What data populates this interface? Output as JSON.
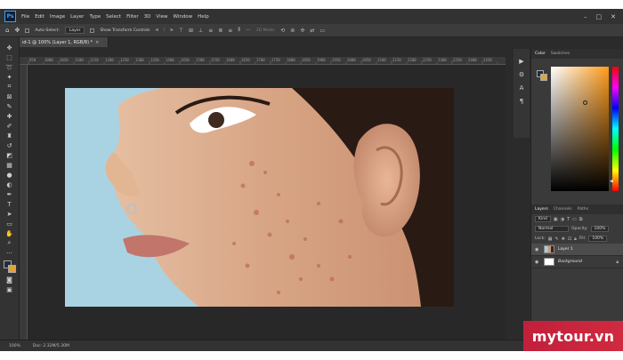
{
  "app": {
    "logo_text": "Ps"
  },
  "menu": [
    "File",
    "Edit",
    "Image",
    "Layer",
    "Type",
    "Select",
    "Filter",
    "3D",
    "View",
    "Window",
    "Help"
  ],
  "window_controls": [
    "–",
    "□",
    "✕"
  ],
  "options_bar": {
    "auto_select_label": "Auto-Select:",
    "auto_select_value": "Layer",
    "transform_label": "Show Transform Controls",
    "mode_3d_label": "3D Mode:"
  },
  "document": {
    "tab_title": "ıd-1 @ 100% (Layer 1, RGB/8) *",
    "close_glyph": "✕"
  },
  "ruler": {
    "ticks": [
      "950",
      "1000",
      "1050",
      "1100",
      "1150",
      "1200",
      "1250",
      "1300",
      "1350",
      "1400",
      "1450",
      "1500",
      "1550",
      "1600",
      "1650",
      "1700",
      "1750",
      "1800",
      "1850",
      "1900",
      "1950",
      "2000",
      "2050",
      "2100",
      "2150",
      "2200",
      "2250",
      "2300",
      "2350",
      "2400",
      "2450"
    ]
  },
  "status": {
    "zoom": "100%",
    "doc_size": "Doc: 2.32M/5.30M"
  },
  "panels": {
    "color_tabs": [
      "Color",
      "Swatches"
    ],
    "color_active": "Color",
    "colors": {
      "foreground": "#1f2d3a",
      "background": "#e0a53a",
      "hue": "#ff9b1a"
    },
    "layers_tabs": [
      "Layers",
      "Channels",
      "Paths"
    ],
    "layers_active": "Layers",
    "kind_label": "Kind",
    "blend_mode": "Normal",
    "opacity_label": "Opacity:",
    "opacity_value": "100%",
    "lock_label": "Lock:",
    "fill_label": "Fill:",
    "fill_value": "100%",
    "layers": [
      {
        "name": "Layer 1",
        "selected": true
      },
      {
        "name": "Background",
        "selected": false
      }
    ]
  },
  "watermark": {
    "text": "mytour.vn"
  }
}
